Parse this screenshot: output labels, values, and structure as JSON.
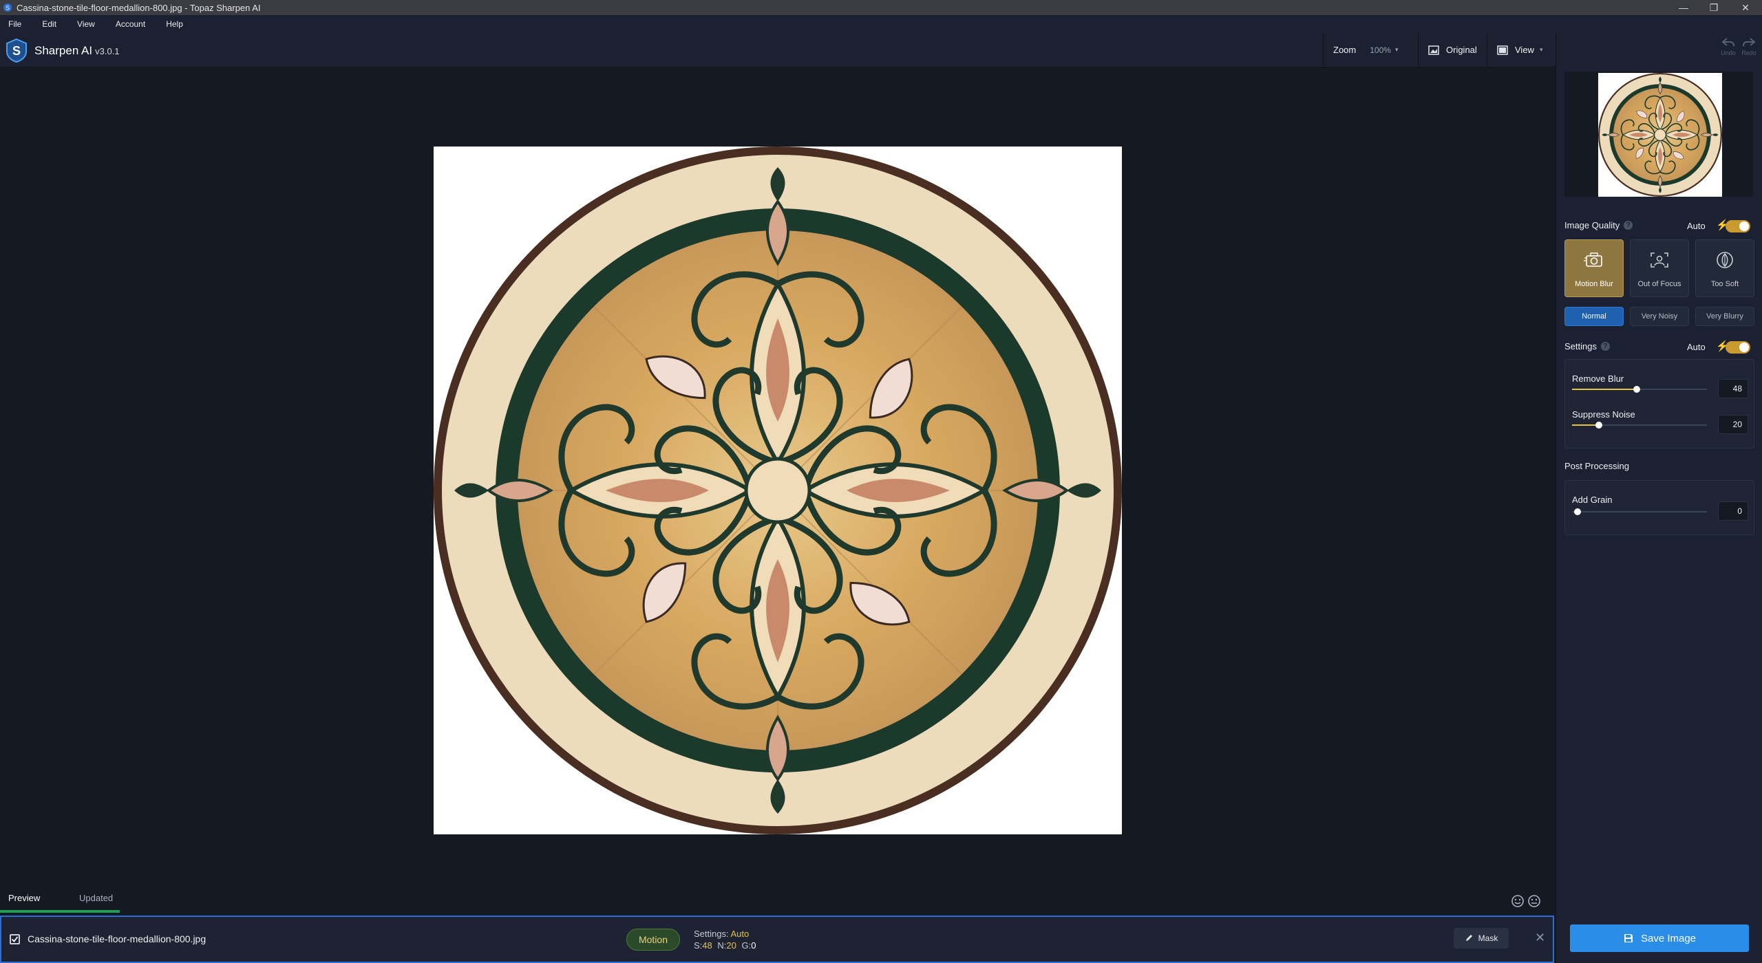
{
  "window": {
    "title": "Cassina-stone-tile-floor-medallion-800.jpg - Topaz Sharpen AI"
  },
  "menu": [
    "File",
    "Edit",
    "View",
    "Account",
    "Help"
  ],
  "header": {
    "app_name": "Sharpen AI",
    "version": "v3.0.1",
    "zoom_label": "Zoom",
    "zoom_value": "100%",
    "original_label": "Original",
    "view_label": "View",
    "undo_label": "Undo",
    "redo_label": "Redo"
  },
  "image_quality": {
    "title": "Image Quality",
    "auto_label": "Auto",
    "auto_enabled": true,
    "modes": [
      "Motion Blur",
      "Out of Focus",
      "Too Soft"
    ],
    "selected_mode": "Motion Blur",
    "levels": [
      "Normal",
      "Very Noisy",
      "Very Blurry"
    ],
    "selected_level": "Normal"
  },
  "settings": {
    "title": "Settings",
    "auto_label": "Auto",
    "auto_enabled": true,
    "remove_blur_label": "Remove Blur",
    "remove_blur": "48",
    "suppress_noise_label": "Suppress Noise",
    "suppress_noise": "20"
  },
  "post_processing": {
    "title": "Post Processing",
    "add_grain_label": "Add Grain",
    "add_grain": "0"
  },
  "preview_tabs": [
    "Preview",
    "Updated"
  ],
  "file_bar": {
    "filename": "Cassina-stone-tile-floor-medallion-800.jpg",
    "mode_pill": "Motion",
    "settings_label": "Settings:",
    "settings_value": "Auto",
    "s_label": "S:",
    "s_value": "48",
    "n_label": "N:",
    "n_value": "20",
    "g_label": "G:",
    "g_value": "0",
    "mask_label": "Mask"
  },
  "save_label": "Save Image",
  "colors": {
    "accent_yellow": "#e7c14d",
    "accent_blue": "#2a8ee8",
    "background": "#141922",
    "panel": "#1b2130"
  }
}
